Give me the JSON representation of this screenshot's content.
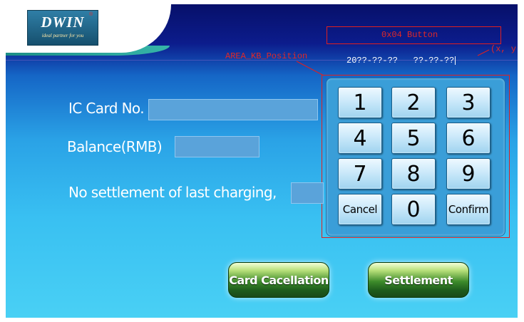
{
  "brand": {
    "name": "DWIN",
    "registered_mark": "®",
    "slogan": "ideal partner for you"
  },
  "annotations": {
    "button_label": "0x04 Button",
    "area_label": "AREA_KB_Position",
    "xy_label": "(x, y)"
  },
  "datetime": {
    "date": "20??-??-??",
    "time": "??-??-??"
  },
  "form": {
    "card_label": "IC Card No.",
    "card_value": "",
    "balance_label": "Balance(RMB)",
    "balance_value": "",
    "settlement_label": "No settlement of last charging,",
    "settlement_value": ""
  },
  "keypad": {
    "keys": [
      "1",
      "2",
      "3",
      "4",
      "5",
      "6",
      "7",
      "8",
      "9"
    ],
    "cancel": "Cancel",
    "zero": "0",
    "confirm": "Confirm"
  },
  "actions": {
    "card_cancel": "Card Cacellation",
    "settlement": "Settlement"
  },
  "colors": {
    "annotation_red": "#e02020",
    "panel_blue": "#3a9ed8",
    "button_green": "#2f7a24"
  }
}
